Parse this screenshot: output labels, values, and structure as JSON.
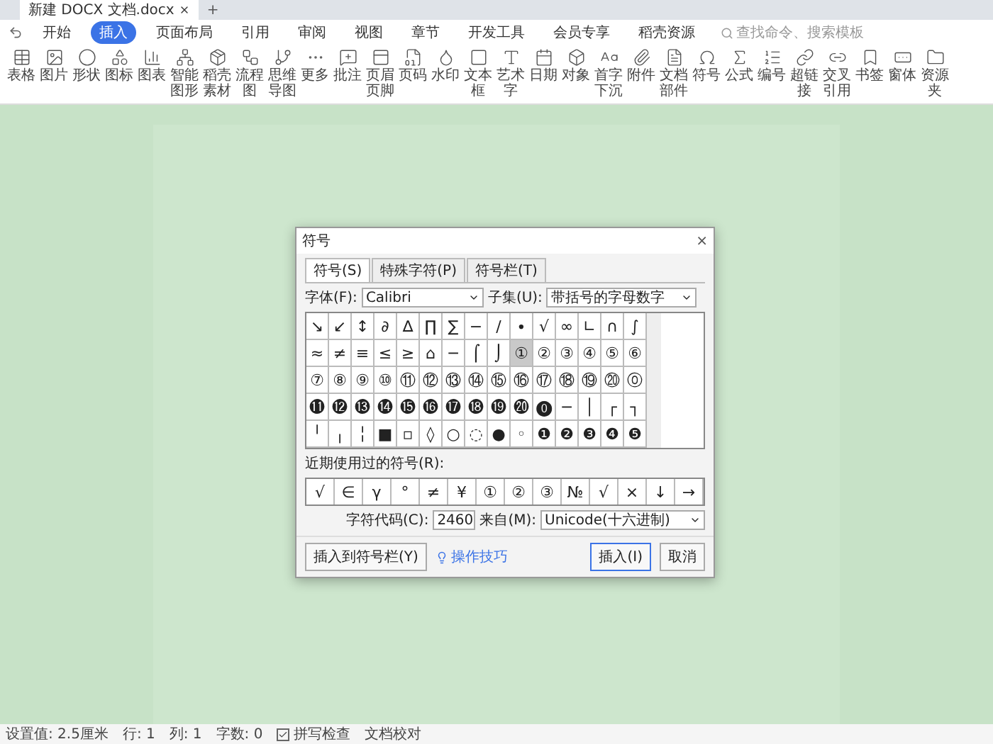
{
  "title_tab": {
    "label": "新建 DOCX 文档.docx",
    "add": "+"
  },
  "menu": [
    {
      "label": "开始",
      "selected": false
    },
    {
      "label": "插入",
      "selected": true
    },
    {
      "label": "页面布局",
      "selected": false
    },
    {
      "label": "引用",
      "selected": false
    },
    {
      "label": "审阅",
      "selected": false
    },
    {
      "label": "视图",
      "selected": false
    },
    {
      "label": "章节",
      "selected": false
    },
    {
      "label": "开发工具",
      "selected": false
    },
    {
      "label": "会员专享",
      "selected": false
    },
    {
      "label": "稻壳资源",
      "selected": false
    }
  ],
  "search": {
    "placeholder": "查找命令、搜索模板"
  },
  "toolbar": [
    "表格",
    "图片",
    "形状",
    "图标",
    "图表",
    "智能图形",
    "稻壳素材",
    "流程图",
    "思维导图",
    "更多",
    "批注",
    "页眉页脚",
    "页码",
    "水印",
    "文本框",
    "艺术字",
    "日期",
    "对象",
    "首字下沉",
    "附件",
    "文档部件",
    "符号",
    "公式",
    "编号",
    "超链接",
    "交叉引用",
    "书签",
    "窗体",
    "资源夹"
  ],
  "dialog": {
    "title": "符号",
    "close": "×",
    "tabs": [
      {
        "label": "符号(S)",
        "selected": true
      },
      {
        "label": "特殊字符(P)",
        "selected": false
      },
      {
        "label": "符号栏(T)",
        "selected": false
      }
    ],
    "font_label": "字体(F):",
    "font_value": "Calibri",
    "subset_label": "子集(U):",
    "subset_value": "带括号的字母数字",
    "grid": [
      [
        {
          "char": "↘",
          "selected": false
        },
        {
          "char": "↙",
          "selected": false
        },
        {
          "char": "↕",
          "selected": false
        },
        {
          "char": "∂",
          "selected": false
        },
        {
          "char": "∆",
          "selected": false
        },
        {
          "char": "∏",
          "selected": false
        },
        {
          "char": "∑",
          "selected": false
        },
        {
          "char": "−",
          "selected": false
        },
        {
          "char": "∕",
          "selected": false
        },
        {
          "char": "∙",
          "selected": false
        },
        {
          "char": "√",
          "selected": false
        },
        {
          "char": "∞",
          "selected": false
        },
        {
          "char": "∟",
          "selected": false
        },
        {
          "char": "∩",
          "selected": false
        },
        {
          "char": "∫",
          "selected": false
        }
      ],
      [
        {
          "char": "≈",
          "selected": false
        },
        {
          "char": "≠",
          "selected": false
        },
        {
          "char": "≡",
          "selected": false
        },
        {
          "char": "≤",
          "selected": false
        },
        {
          "char": "≥",
          "selected": false
        },
        {
          "char": "⌂",
          "selected": false
        },
        {
          "char": "─",
          "selected": false
        },
        {
          "char": "⌠",
          "selected": false
        },
        {
          "char": "⌡",
          "selected": false
        },
        {
          "char": "①",
          "selected": true
        },
        {
          "char": "②",
          "selected": false
        },
        {
          "char": "③",
          "selected": false
        },
        {
          "char": "④",
          "selected": false
        },
        {
          "char": "⑤",
          "selected": false
        },
        {
          "char": "⑥",
          "selected": false
        }
      ],
      [
        {
          "char": "⑦",
          "selected": false
        },
        {
          "char": "⑧",
          "selected": false
        },
        {
          "char": "⑨",
          "selected": false
        },
        {
          "char": "⑩",
          "selected": false
        },
        {
          "char": "⑪",
          "selected": false
        },
        {
          "char": "⑫",
          "selected": false
        },
        {
          "char": "⑬",
          "selected": false
        },
        {
          "char": "⑭",
          "selected": false
        },
        {
          "char": "⑮",
          "selected": false
        },
        {
          "char": "⑯",
          "selected": false
        },
        {
          "char": "⑰",
          "selected": false
        },
        {
          "char": "⑱",
          "selected": false
        },
        {
          "char": "⑲",
          "selected": false
        },
        {
          "char": "⑳",
          "selected": false
        },
        {
          "char": "⓪",
          "selected": false
        }
      ],
      [
        {
          "char": "⓫",
          "selected": false
        },
        {
          "char": "⓬",
          "selected": false
        },
        {
          "char": "⓭",
          "selected": false
        },
        {
          "char": "⓮",
          "selected": false
        },
        {
          "char": "⓯",
          "selected": false
        },
        {
          "char": "⓰",
          "selected": false
        },
        {
          "char": "⓱",
          "selected": false
        },
        {
          "char": "⓲",
          "selected": false
        },
        {
          "char": "⓳",
          "selected": false
        },
        {
          "char": "⓴",
          "selected": false
        },
        {
          "char": "⓿",
          "selected": false
        },
        {
          "char": "─",
          "selected": false
        },
        {
          "char": "│",
          "selected": false
        },
        {
          "char": "┌",
          "selected": false
        },
        {
          "char": "┐",
          "selected": false
        }
      ],
      [
        {
          "char": "╵",
          "selected": false
        },
        {
          "char": "╷",
          "selected": false
        },
        {
          "char": "╎",
          "selected": false
        },
        {
          "char": "■",
          "selected": false
        },
        {
          "char": "▫",
          "selected": false
        },
        {
          "char": "◊",
          "selected": false
        },
        {
          "char": "○",
          "selected": false
        },
        {
          "char": "◌",
          "selected": false
        },
        {
          "char": "●",
          "selected": false
        },
        {
          "char": "◦",
          "selected": false
        },
        {
          "char": "❶",
          "selected": false
        },
        {
          "char": "❷",
          "selected": false
        },
        {
          "char": "❸",
          "selected": false
        },
        {
          "char": "❹",
          "selected": false
        },
        {
          "char": "❺",
          "selected": false
        }
      ]
    ],
    "recent_label": "近期使用过的符号(R):",
    "recent": [
      "√",
      "∈",
      "γ",
      "°",
      "≠",
      "¥",
      "①",
      "②",
      "③",
      "№",
      "√",
      "×",
      "↓",
      "→"
    ],
    "code_label": "字符代码(C):",
    "code_value": "2460",
    "from_label": "来自(M):",
    "from_value": "Unicode(十六进制)",
    "insert_bar": "插入到符号栏(Y)",
    "tips": "操作技巧",
    "insert": "插入(I)",
    "cancel": "取消"
  },
  "status_bar": [
    "设置值: 2.5厘米",
    "行: 1",
    "列: 1",
    "字数: 0"
  ],
  "spell_check": {
    "label": "拼写检查",
    "checked": true
  },
  "proofread": "文档校对"
}
